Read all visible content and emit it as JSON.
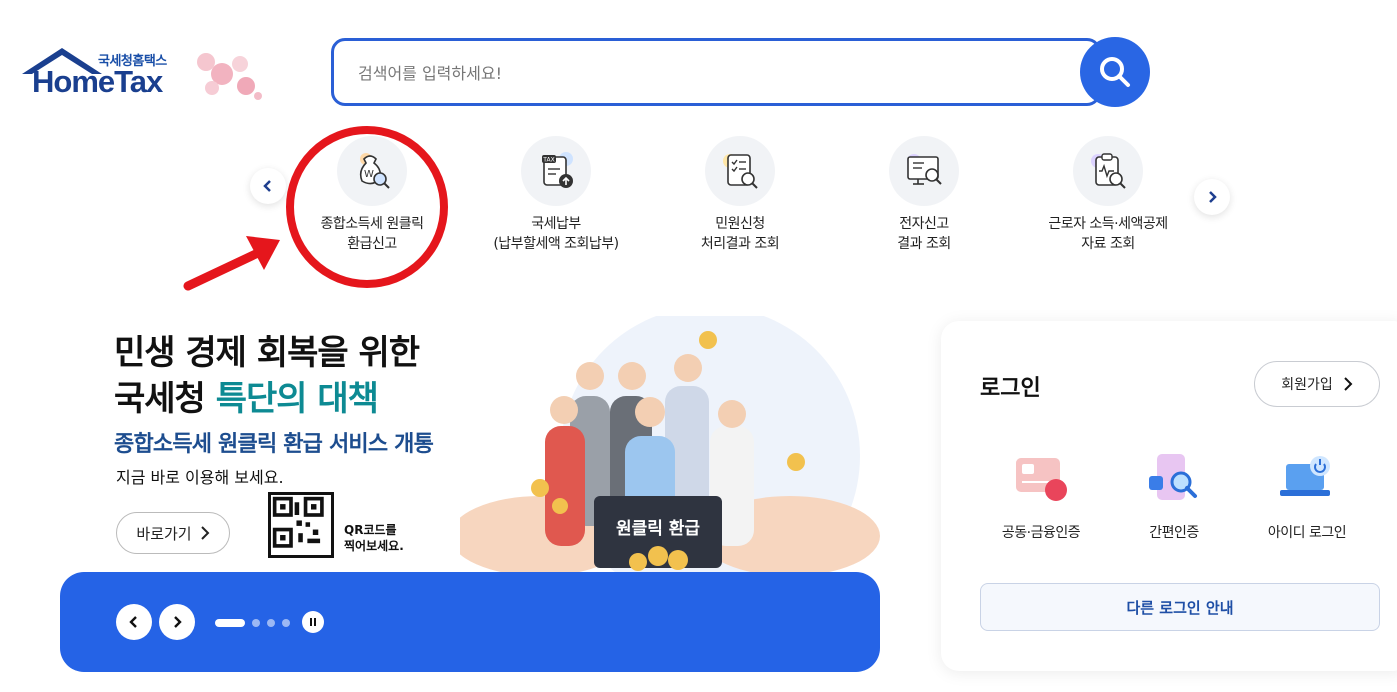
{
  "logo": {
    "sub": "국세청홈택스",
    "main": "HomeTax"
  },
  "search": {
    "placeholder": "검색어를 입력하세요!"
  },
  "quick_menu": {
    "items": [
      {
        "label": "종합소득세 원클릭\n환급신고",
        "icon": "money-bag-search-icon"
      },
      {
        "label": "국세납부\n(납부할세액 조회납부)",
        "icon": "tax-document-upload-icon"
      },
      {
        "label": "민원신청\n처리결과 조회",
        "icon": "checklist-search-icon"
      },
      {
        "label": "전자신고\n결과 조회",
        "icon": "monitor-search-icon"
      },
      {
        "label": "근로자 소득·세액공제\n자료 조회",
        "icon": "receipt-search-icon"
      }
    ]
  },
  "banner": {
    "title_line1": "민생 경제 회복을 위한",
    "title_line2_prefix": "국세청 ",
    "title_line2_accent": "특단의 대책",
    "subtitle": "종합소득세 원클릭 환급 서비스 개통",
    "description": "지금 바로 이용해 보세요.",
    "go_button": "바로가기",
    "qr_text": "QR코드를\n찍어보세요.",
    "illustration_sign": "원클릭 환급"
  },
  "slider": {
    "total_slides": 4,
    "current_slide": 1
  },
  "login": {
    "title": "로그인",
    "signup": "회원가입",
    "options": [
      {
        "label": "공동·금융인증",
        "icon": "certificate-card-icon"
      },
      {
        "label": "간편인증",
        "icon": "phone-search-icon"
      },
      {
        "label": "아이디 로그인",
        "icon": "laptop-power-icon"
      }
    ],
    "other": "다른 로그인 안내"
  },
  "colors": {
    "brand": "#2563e6",
    "annotation": "#e5161c",
    "accent": "#0d8a93"
  }
}
